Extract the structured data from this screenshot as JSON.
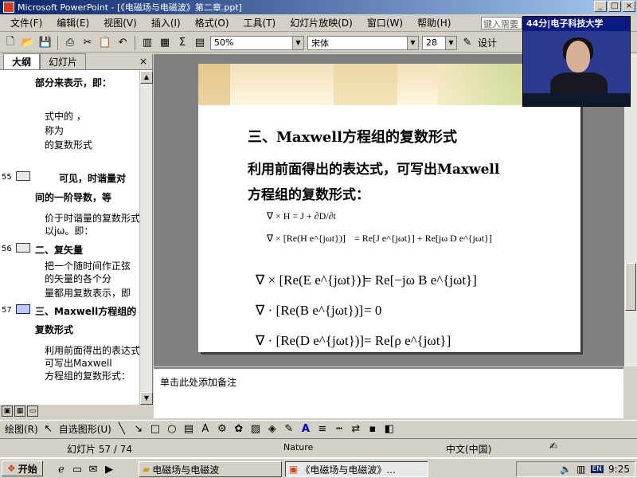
{
  "window": {
    "title": "Microsoft PowerPoint - [《电磁场与电磁波》第二章.ppt]",
    "controls": [
      "_",
      "□",
      "×"
    ]
  },
  "menu": {
    "items": [
      "文件(F)",
      "编辑(E)",
      "视图(V)",
      "插入(I)",
      "格式(O)",
      "工具(T)",
      "幻灯片放映(D)",
      "窗口(W)",
      "帮助(H)"
    ],
    "help_placeholder": "键入需要"
  },
  "toolbar": {
    "zoom": "50%",
    "font": "宋体",
    "font_size": "28",
    "design_label": "设计"
  },
  "outline_pane": {
    "tabs": [
      "大纲",
      "幻灯片"
    ],
    "close": "×",
    "lines": [
      {
        "text": "部分来表示，即：",
        "bold": true
      },
      {
        "text": "式中的             ，",
        "bold": false
      },
      {
        "text": "称为",
        "bold": false
      },
      {
        "text": "的复数形式",
        "bold": false
      },
      {
        "num": "55",
        "text": "可见，时谐量对",
        "bold": true
      },
      {
        "text": "间的一阶导数，等",
        "bold": true
      },
      {
        "text": "价于时谐量的复数形式",
        "bold": false
      },
      {
        "text": "以jω。即：",
        "bold": false
      },
      {
        "num": "56",
        "text": "二、复矢量",
        "bold": true
      },
      {
        "text": "把一个随时间作正弦",
        "bold": false
      },
      {
        "text": "的矢量的各个分",
        "bold": false
      },
      {
        "text": "量都用复数表示，即",
        "bold": false
      },
      {
        "num": "57",
        "text": "三、Maxwell方程组的",
        "bold": true
      },
      {
        "text": "复数形式",
        "bold": true
      },
      {
        "text": "利用前面得出的表达式",
        "bold": false
      },
      {
        "text": "可写出Maxwell",
        "bold": false
      },
      {
        "text": "方程组的复数形式：",
        "bold": false
      }
    ]
  },
  "slide": {
    "title": "三、Maxwell方程组的复数形式",
    "body_lines": [
      "利用前面得出的表达式，可写出Maxwell",
      "方程组的复数形式："
    ],
    "equations": {
      "eq1": "∇ × H = J + ∂D/∂t",
      "eq2_left": "∇ × [Re(H e^{jωt})]",
      "eq2_right": "= Re[J e^{jωt}] + Re[jω D e^{jωt}]",
      "eq3_left": "∇ × [Re(E e^{jωt})]",
      "eq3_right": "= Re[−jω B e^{jωt}]",
      "eq4_left": "∇ · [Re(B e^{jωt})]",
      "eq4_right": "= 0",
      "eq5_left": "∇ · [Re(D e^{jωt})]",
      "eq5_right": "= Re[ρ e^{jωt}]"
    }
  },
  "notes": {
    "placeholder": "单击此处添加备注"
  },
  "drawing_toolbar": {
    "draw_label": "绘图(R)",
    "autoshape_label": "自选图形(U)"
  },
  "status": {
    "slide_counter": "幻灯片 57 / 74",
    "design": "Nature",
    "language": "中文(中国)"
  },
  "taskbar": {
    "start": "开始",
    "tasks": [
      "电磁场与电磁波",
      "《电磁场与电磁波》..."
    ],
    "clock": "9:25"
  },
  "video": {
    "label": "44分|电子科技大学"
  }
}
